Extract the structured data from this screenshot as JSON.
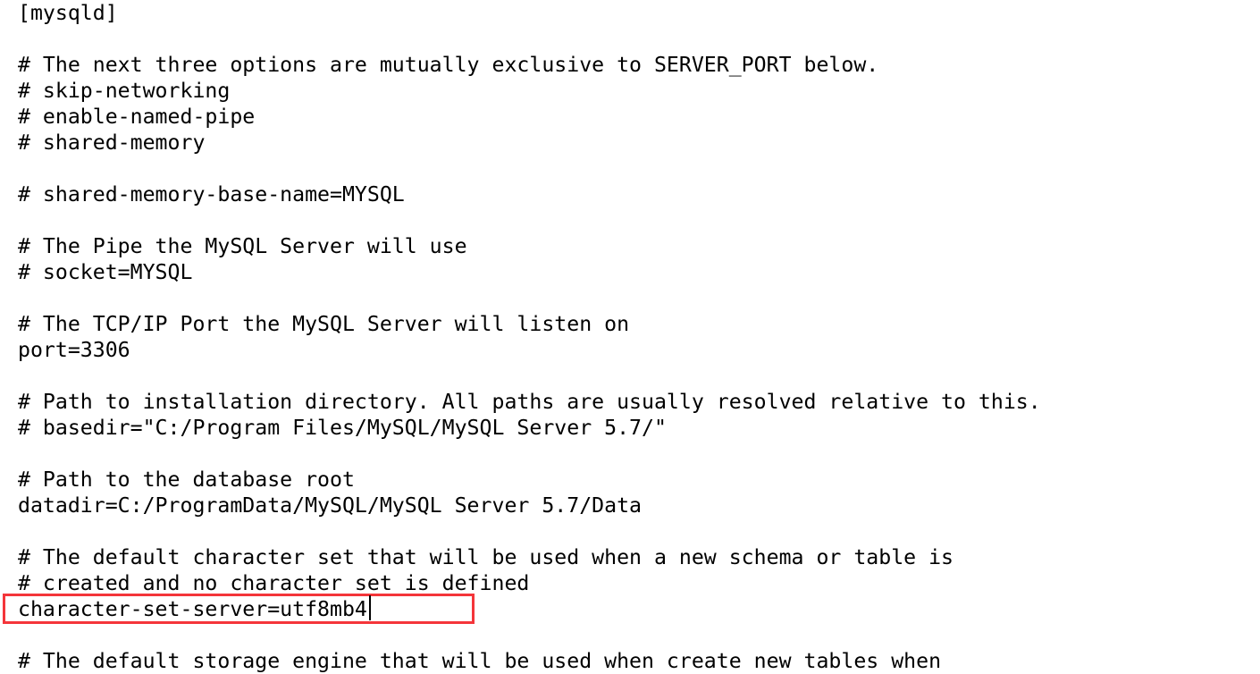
{
  "editor": {
    "file_type": "mysql-config",
    "caret_char": "|",
    "annotation_color": "#f4353a",
    "text_color": "#000000",
    "background_color": "#ffffff"
  },
  "lines": [
    {
      "text": "[mysqld]"
    },
    {
      "text": ""
    },
    {
      "text": "# The next three options are mutually exclusive to SERVER_PORT below."
    },
    {
      "text": "# skip-networking"
    },
    {
      "text": "# enable-named-pipe"
    },
    {
      "text": "# shared-memory"
    },
    {
      "text": ""
    },
    {
      "text": "# shared-memory-base-name=MYSQL"
    },
    {
      "text": ""
    },
    {
      "text": "# The Pipe the MySQL Server will use"
    },
    {
      "text": "# socket=MYSQL"
    },
    {
      "text": ""
    },
    {
      "text": "# The TCP/IP Port the MySQL Server will listen on"
    },
    {
      "text": "port=3306"
    },
    {
      "text": ""
    },
    {
      "text": "# Path to installation directory. All paths are usually resolved relative to this."
    },
    {
      "text": "# basedir=\"C:/Program Files/MySQL/MySQL Server 5.7/\""
    },
    {
      "text": ""
    },
    {
      "text": "# Path to the database root"
    },
    {
      "text": "datadir=C:/ProgramData/MySQL/MySQL Server 5.7/Data"
    },
    {
      "text": ""
    },
    {
      "text": "# The default character set that will be used when a new schema or table is"
    },
    {
      "text": "# created and no character set is defined"
    },
    {
      "text": "character-set-server=utf8mb4"
    },
    {
      "text": ""
    },
    {
      "text": "# The default storage engine that will be used when create new tables when"
    }
  ],
  "highlighted_line": {
    "index": 23,
    "text": "character-set-server=utf8mb4",
    "key": "character-set-server",
    "value": "utf8mb4"
  }
}
